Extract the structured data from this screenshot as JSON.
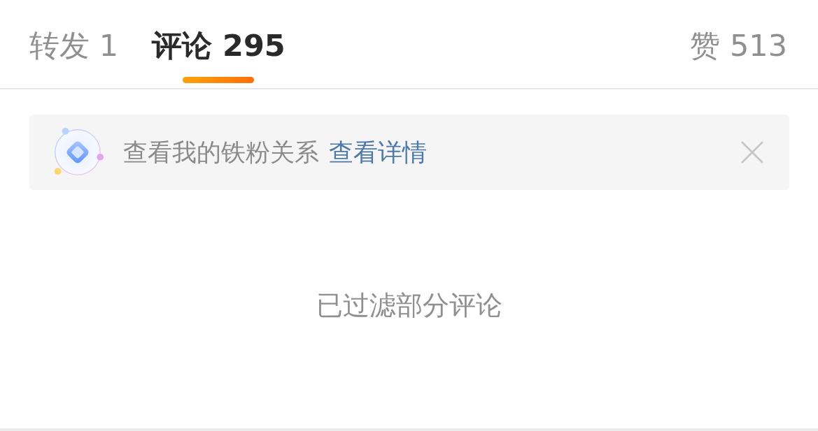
{
  "tabs": [
    {
      "label": "转发 1",
      "selected": false
    },
    {
      "label": "评论 295",
      "selected": true
    },
    {
      "label": "赞 513",
      "selected": false
    }
  ],
  "banner": {
    "text": "查看我的铁粉关系",
    "link": "查看详情"
  },
  "notice": "已过滤部分评论"
}
